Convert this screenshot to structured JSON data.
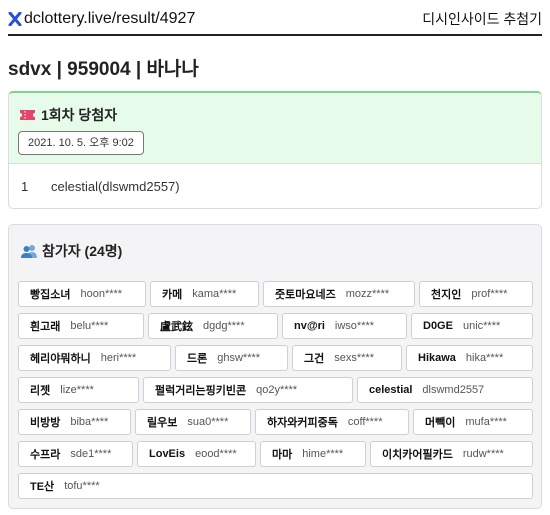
{
  "header": {
    "site_url": "dclottery.live/result/4927",
    "tool_title": "디시인사이드 추첨기"
  },
  "result_title": "sdvx | 959004 | 바나나",
  "winners": {
    "heading": "1회차 당첨자",
    "time": "2021. 10. 5. 오후 9:02",
    "rows": [
      {
        "rank": "1",
        "name": "celestial(dlswmd2557)"
      }
    ]
  },
  "participants": {
    "heading": "참가자 (24명)",
    "list": [
      {
        "nick": "빵집소녀",
        "uid": "hoon****"
      },
      {
        "nick": "카메",
        "uid": "kama****"
      },
      {
        "nick": "줏토마요네즈",
        "uid": "mozz****"
      },
      {
        "nick": "천지인",
        "uid": "prof****"
      },
      {
        "nick": "흰고래",
        "uid": "belu****"
      },
      {
        "nick": "盧武鉉",
        "uid": "dgdg****"
      },
      {
        "nick": "nv@ri",
        "uid": "iwso****"
      },
      {
        "nick": "D0GE",
        "uid": "unic****"
      },
      {
        "nick": "헤리야뭐하니",
        "uid": "heri****"
      },
      {
        "nick": "드론",
        "uid": "ghsw****"
      },
      {
        "nick": "그건",
        "uid": "sexs****"
      },
      {
        "nick": "Hikawa",
        "uid": "hika****"
      },
      {
        "nick": "리젯",
        "uid": "lize****"
      },
      {
        "nick": "펄럭거리는핑키빈콘",
        "uid": "qo2y****"
      },
      {
        "nick": "celestial",
        "uid": "dlswmd2557"
      },
      {
        "nick": "비방방",
        "uid": "biba****"
      },
      {
        "nick": "릴우보",
        "uid": "sua0****"
      },
      {
        "nick": "하자와커피중독",
        "uid": "coff****"
      },
      {
        "nick": "머빽이",
        "uid": "mufa****"
      },
      {
        "nick": "수프라",
        "uid": "sde1****"
      },
      {
        "nick": "LovEis",
        "uid": "eood****"
      },
      {
        "nick": "마마",
        "uid": "hime****"
      },
      {
        "nick": "이치카어필카드",
        "uid": "rudw****"
      },
      {
        "nick": "TE산",
        "uid": "tofu****"
      }
    ]
  }
}
